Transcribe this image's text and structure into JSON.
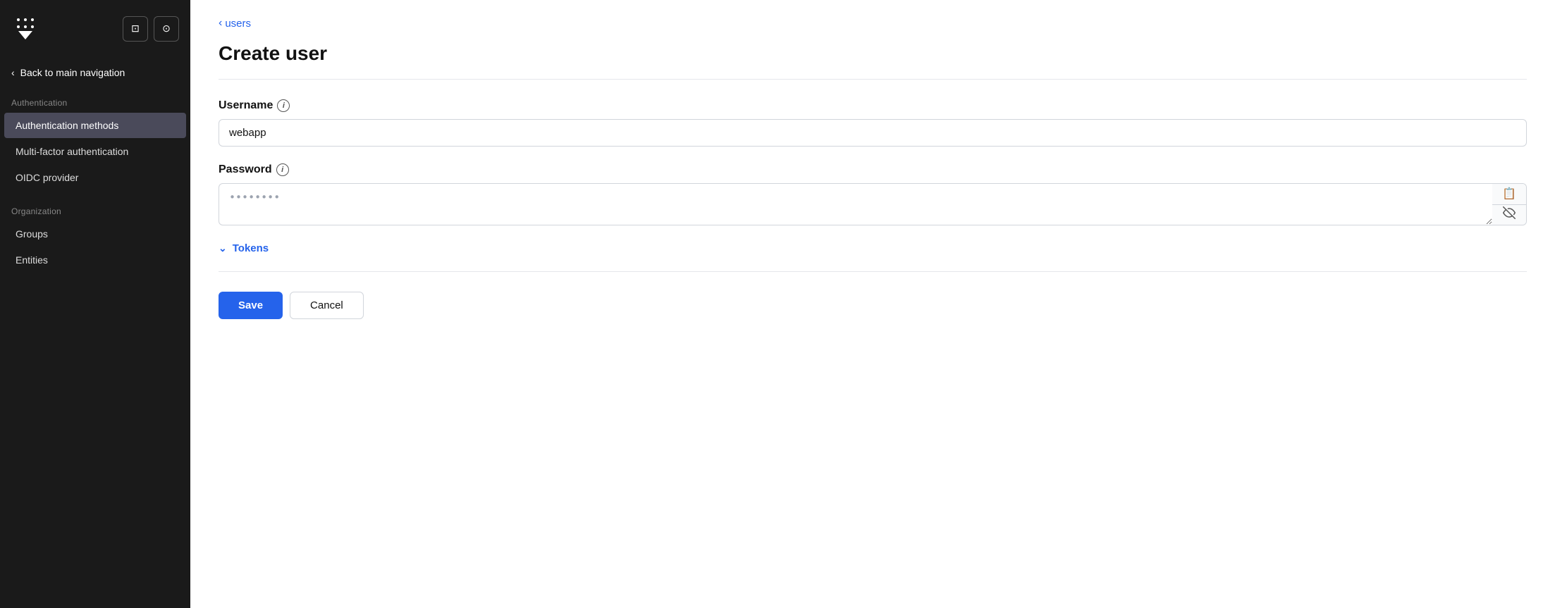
{
  "sidebar": {
    "back_label": "Back to main navigation",
    "sections": [
      {
        "label": "Authentication",
        "items": [
          {
            "id": "auth-methods",
            "label": "Authentication methods",
            "active": true
          },
          {
            "id": "mfa",
            "label": "Multi-factor authentication",
            "active": false
          },
          {
            "id": "oidc",
            "label": "OIDC provider",
            "active": false
          }
        ]
      },
      {
        "label": "Organization",
        "items": [
          {
            "id": "groups",
            "label": "Groups",
            "active": false
          },
          {
            "id": "entities",
            "label": "Entities",
            "active": false
          }
        ]
      }
    ]
  },
  "header": {
    "terminal_icon": ">_",
    "user_icon": "👤"
  },
  "breadcrumb": {
    "chevron": "‹",
    "link_label": "users"
  },
  "page": {
    "title": "Create user",
    "username_label": "Username",
    "username_value": "webapp",
    "username_placeholder": "webapp",
    "password_label": "Password",
    "password_placeholder": "••••••••",
    "tokens_label": "Tokens",
    "tokens_chevron": "∨"
  },
  "actions": {
    "save_label": "Save",
    "cancel_label": "Cancel"
  }
}
